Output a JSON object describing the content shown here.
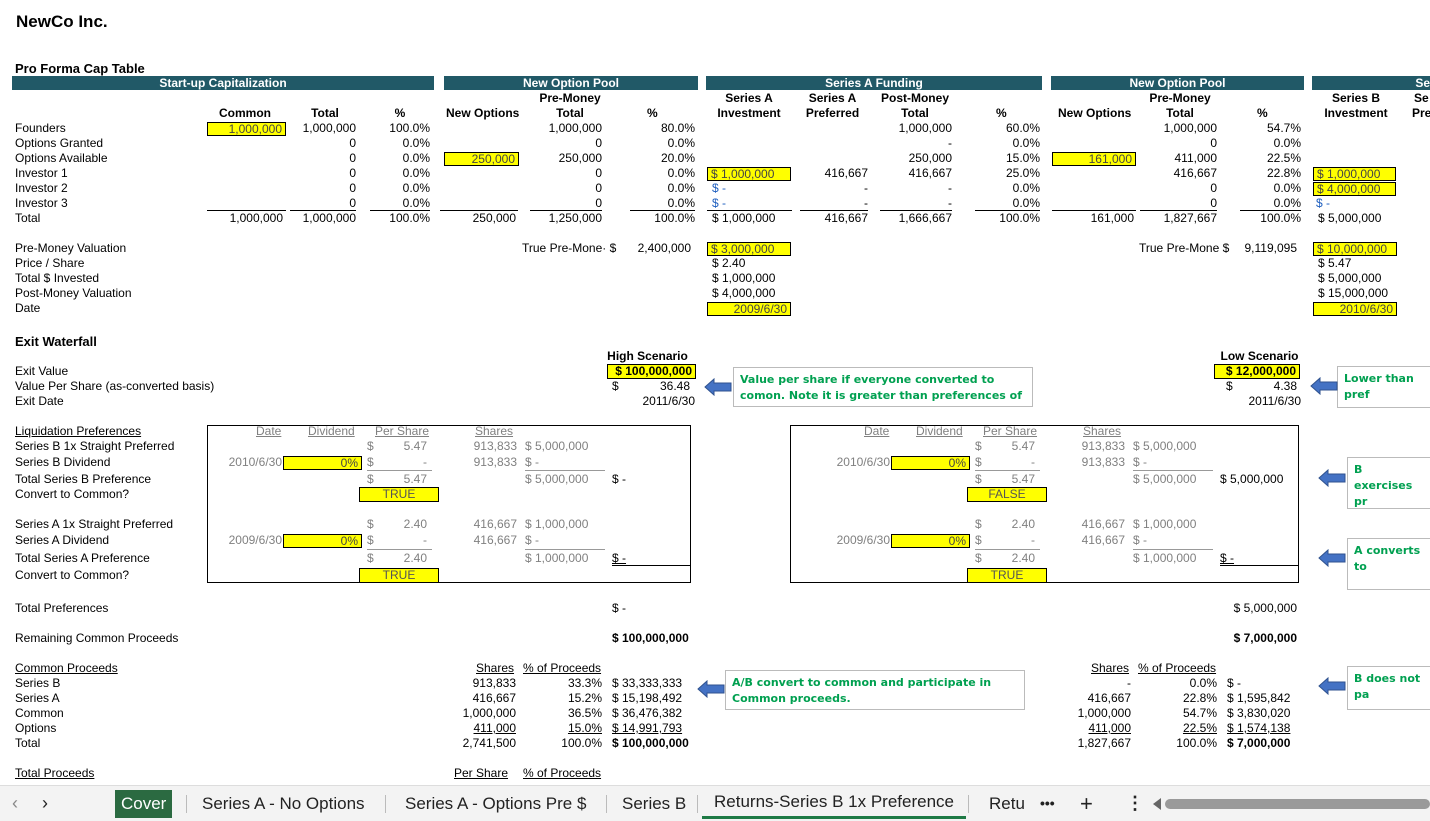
{
  "company": "NewCo Inc.",
  "section_captable": "Pro Forma Cap Table",
  "headers": {
    "startup": "Start-up Capitalization",
    "pool1": "New Option Pool",
    "seriesA": "Series A Funding",
    "pool2": "New Option Pool",
    "seriesB_cut": "Se"
  },
  "subheaders": {
    "common": "Common",
    "total": "Total",
    "pct": "%",
    "new_options": "New Options",
    "pre_money": "Pre-Money",
    "series_a": "Series A",
    "investment": "Investment",
    "preferred": "Preferred",
    "post_money": "Post-Money",
    "series_b": "Series B",
    "se_cut": "Se",
    "pre_cut": "Pre"
  },
  "rows": [
    "Founders",
    "Options Granted",
    "Options Available",
    "Investor 1",
    "Investor 2",
    "Investor 3",
    "Total"
  ],
  "startup": {
    "common": [
      "1,000,000",
      "",
      "",
      "",
      "",
      "",
      "1,000,000"
    ],
    "total": [
      "1,000,000",
      "0",
      "0",
      "0",
      "0",
      "0",
      "1,000,000"
    ],
    "pct": [
      "100.0%",
      "0.0%",
      "0.0%",
      "0.0%",
      "0.0%",
      "0.0%",
      "100.0%"
    ]
  },
  "pool1": {
    "new_options": [
      "",
      "",
      "250,000",
      "",
      "",
      "",
      "250,000"
    ],
    "total": [
      "1,000,000",
      "0",
      "250,000",
      "0",
      "0",
      "0",
      "1,250,000"
    ],
    "pct": [
      "80.0%",
      "0.0%",
      "20.0%",
      "0.0%",
      "0.0%",
      "0.0%",
      "100.0%"
    ]
  },
  "seriesA": {
    "inv": [
      "",
      "",
      "",
      "$  1,000,000",
      "$          -",
      "$          -",
      "$  1,000,000"
    ],
    "pref": [
      "",
      "",
      "",
      "416,667",
      "-",
      "-",
      "416,667"
    ],
    "total": [
      "1,000,000",
      "-",
      "250,000",
      "416,667",
      "-",
      "-",
      "1,666,667"
    ],
    "pct": [
      "60.0%",
      "0.0%",
      "15.0%",
      "25.0%",
      "0.0%",
      "0.0%",
      "100.0%"
    ]
  },
  "pool2": {
    "new_options": [
      "",
      "",
      "161,000",
      "",
      "",
      "",
      "161,000"
    ],
    "total": [
      "1,000,000",
      "0",
      "411,000",
      "416,667",
      "0",
      "0",
      "1,827,667"
    ],
    "pct": [
      "54.7%",
      "0.0%",
      "22.5%",
      "22.8%",
      "0.0%",
      "0.0%",
      "100.0%"
    ]
  },
  "seriesB": {
    "inv": [
      "",
      "",
      "",
      "$  1,000,000",
      "$  4,000,000",
      "$          -",
      "$  5,000,000"
    ]
  },
  "valuation_labels": [
    "Pre-Money Valuation",
    "Price / Share",
    "Total $ Invested",
    "Post-Money Valuation",
    "Date"
  ],
  "true_pre1_label": "True Pre-Mone· $",
  "true_pre1_value": "2,400,000",
  "seriesA_val": [
    "$  3,000,000",
    "$          2.40",
    "$  1,000,000",
    "$  4,000,000",
    "2009/6/30"
  ],
  "true_pre2_label": "True Pre-Mone $",
  "true_pre2_value": "9,119,095",
  "seriesB_val": [
    "$ 10,000,000",
    "$          5.47",
    "$  5,000,000",
    "$ 15,000,000",
    "2010/6/30"
  ],
  "section_waterfall": "Exit Waterfall",
  "exit_labels": [
    "Exit Value",
    "Value Per Share (as-converted basis)",
    "Exit Date"
  ],
  "high": {
    "title": "High Scenario",
    "exit_value": "$ 100,000,000",
    "vps_sym": "$",
    "vps": "36.48",
    "date": "2011/6/30"
  },
  "low": {
    "title": "Low Scenario",
    "exit_value": "$ 12,000,000",
    "vps_sym": "$",
    "vps": "4.38",
    "date": "2011/6/30"
  },
  "notes": {
    "n1": "Value per share if everyone converted to comon. Note it is greater than preferences of A and B.",
    "n2": "Lower than pref",
    "n3": "B exercises pr",
    "n4": "A converts to",
    "n5": "A/B convert to common and participate in Common proceeds.",
    "n6": "B does not pa"
  },
  "liq_labels": [
    "Liquidation Preferences",
    "Series B 1x Straight Preferred",
    "Series B Dividend",
    "Total Series B Preference",
    "Convert to Common?",
    "Series A 1x Straight Preferred",
    "Series A Dividend",
    "Total Series A Preference",
    "Convert to Common?"
  ],
  "liq_hdr": {
    "date": "Date",
    "dividend": "Dividend",
    "per_share": "Per Share",
    "shares": "Shares"
  },
  "liqH": {
    "b_ps": "5.47",
    "b_date": "2010/6/30",
    "b_div": "0%",
    "b_tot_ps": "5.47",
    "b_conv": "TRUE",
    "b_sh1": "913,833",
    "b_amt1": "$  5,000,000",
    "b_sh2": "913,833",
    "b_amt2": "$          -",
    "b_tot": "$  5,000,000",
    "b_res": "$            -",
    "a_ps": "2.40",
    "a_date": "2009/6/30",
    "a_div": "0%",
    "a_tot_ps": "2.40",
    "a_conv": "TRUE",
    "a_sh1": "416,667",
    "a_amt1": "$  1,000,000",
    "a_sh2": "416,667",
    "a_amt2": "$          -",
    "a_tot": "$  1,000,000",
    "a_res": "$            -"
  },
  "liqL": {
    "b_ps": "5.47",
    "b_date": "2010/6/30",
    "b_div": "0%",
    "b_tot_ps": "5.47",
    "b_conv": "FALSE",
    "b_sh1": "913,833",
    "b_amt1": "$  5,000,000",
    "b_sh2": "913,833",
    "b_amt2": "$          -",
    "b_tot": "$  5,000,000",
    "b_res": "$  5,000,000",
    "a_ps": "2.40",
    "a_date": "2009/6/30",
    "a_div": "0%",
    "a_tot_ps": "2.40",
    "a_conv": "TRUE",
    "a_sh1": "416,667",
    "a_amt1": "$  1,000,000",
    "a_sh2": "416,667",
    "a_amt2": "$          -",
    "a_tot": "$  1,000,000",
    "a_res": "$            -"
  },
  "totals_labels": [
    "Total Preferences",
    "Remaining Common Proceeds"
  ],
  "high_totals": [
    "$                -",
    "$ 100,000,000"
  ],
  "low_totals": [
    "$  5,000,000",
    "$  7,000,000"
  ],
  "common_labels": [
    "Common Proceeds",
    "Series B",
    "Series A",
    "Common",
    "Options",
    "Total"
  ],
  "cp_hdr": {
    "shares": "Shares",
    "pct": "% of Proceeds"
  },
  "cpH": {
    "shares": [
      "913,833",
      "416,667",
      "1,000,000",
      "411,000",
      "2,741,500"
    ],
    "pct": [
      "33.3%",
      "15.2%",
      "36.5%",
      "15.0%",
      "100.0%"
    ],
    "amt": [
      "$  33,333,333",
      "$  15,198,492",
      "$  36,476,382",
      "$  14,991,793",
      "$ 100,000,000"
    ]
  },
  "cpL": {
    "shares": [
      "-",
      "416,667",
      "1,000,000",
      "411,000",
      "1,827,667"
    ],
    "pct": [
      "0.0%",
      "22.8%",
      "54.7%",
      "22.5%",
      "100.0%"
    ],
    "amt": [
      "$              -",
      "$  1,595,842",
      "$  3,830,020",
      "$  1,574,138",
      "$  7,000,000"
    ]
  },
  "total_proceeds": "Total Proceeds",
  "tp_hdr": {
    "per_share": "Per Share",
    "pct": "% of Proceeds"
  },
  "tabs": [
    "Cover",
    "Series A - No Options",
    "Series A - Options Pre $",
    "Series B",
    "Returns-Series B 1x Preference",
    "Retu"
  ],
  "colors": {
    "header_bg": "#215967",
    "input_bg": "#ffff00",
    "note_text": "#00a050",
    "active_tab": "#2b6a41",
    "arrow": "#4472c4"
  }
}
